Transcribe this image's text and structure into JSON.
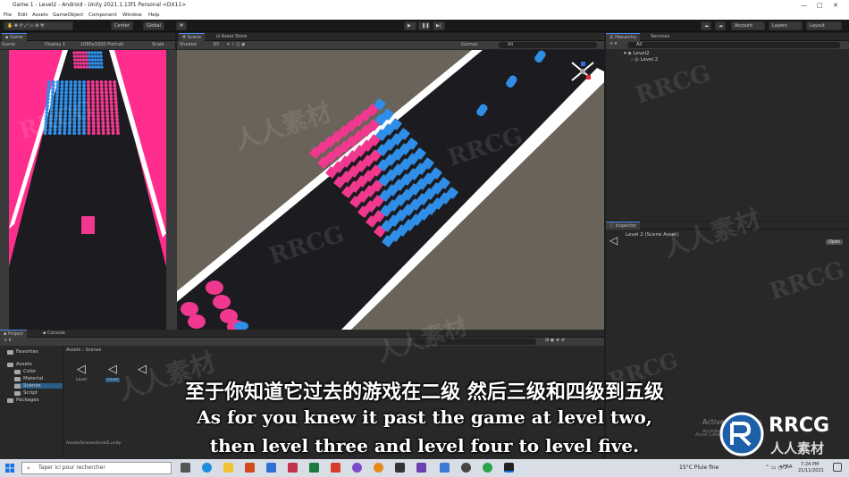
{
  "window": {
    "title": "Game 1 - Level2 - Android - Unity 2021.1.13f1 Personal <DX11>",
    "controls": [
      "—",
      "□",
      "✕"
    ]
  },
  "menu": [
    "File",
    "Edit",
    "Assets",
    "GameObject",
    "Component",
    "Window",
    "Help"
  ],
  "toolbar": {
    "center_label": "Center",
    "global_label": "Global",
    "account_label": "Account",
    "layers_label": "Layers",
    "layout_label": "Layout"
  },
  "game_panel": {
    "tab_label": "Game",
    "display_mode": "Game",
    "display": "Display 1",
    "resolution": "1080x1920 Portrait",
    "scale_label": "Scale"
  },
  "scene_panel": {
    "tabs": [
      "Scene",
      "Asset Store"
    ],
    "shading": "Shaded",
    "mode_2d": "2D",
    "gizmos": "Gizmos",
    "search_placeholder": "All"
  },
  "hierarchy": {
    "tabs": [
      "Hierarchy",
      "Services"
    ],
    "search_placeholder": "All",
    "items": [
      "Level2",
      "Level 2"
    ]
  },
  "inspector": {
    "tab_label": "Inspector",
    "object_name": "Level 2 (Scene Asset)",
    "asset_labels": "Asset Labels",
    "open_button": "Open"
  },
  "project": {
    "tabs": [
      "Project",
      "Console"
    ],
    "breadcrumb": [
      "Assets",
      "Scenes"
    ],
    "favorites_label": "Favorites",
    "tree": [
      {
        "label": "Assets",
        "indent": 0
      },
      {
        "label": "Color",
        "indent": 1
      },
      {
        "label": "Material",
        "indent": 1
      },
      {
        "label": "Scenes",
        "indent": 1
      },
      {
        "label": "Script",
        "indent": 1
      },
      {
        "label": "Packages",
        "indent": 0
      }
    ],
    "assets": [
      "Level",
      "Level",
      ""
    ],
    "path": "Assets/Scenes/Level2.unity"
  },
  "subtitles": {
    "chinese": "至于你知道它过去的游戏在二级 然后三级和四级到五级",
    "line1": "As for you knew it past the game at level two,",
    "line2": "then level three and level four to level five."
  },
  "activation": {
    "title": "Activer Windows",
    "subtitle": "Accédez aux paramètres"
  },
  "logo": {
    "main": "RRCG",
    "sub": "人人素材"
  },
  "watermarks": [
    "RRCG",
    "人人素材"
  ],
  "taskbar": {
    "search_placeholder": "Taper ici pour rechercher",
    "weather": "15°C  Pluie fine",
    "language": "FRA",
    "time": "7:24 PM",
    "date": "21/11/2021"
  },
  "colors": {
    "game_bg": "#ff2e8e",
    "cube_blue": "#2f8fe8",
    "cube_pink": "#f0388f",
    "road": "#1c1c20",
    "scene_ground": "#6a6359"
  }
}
